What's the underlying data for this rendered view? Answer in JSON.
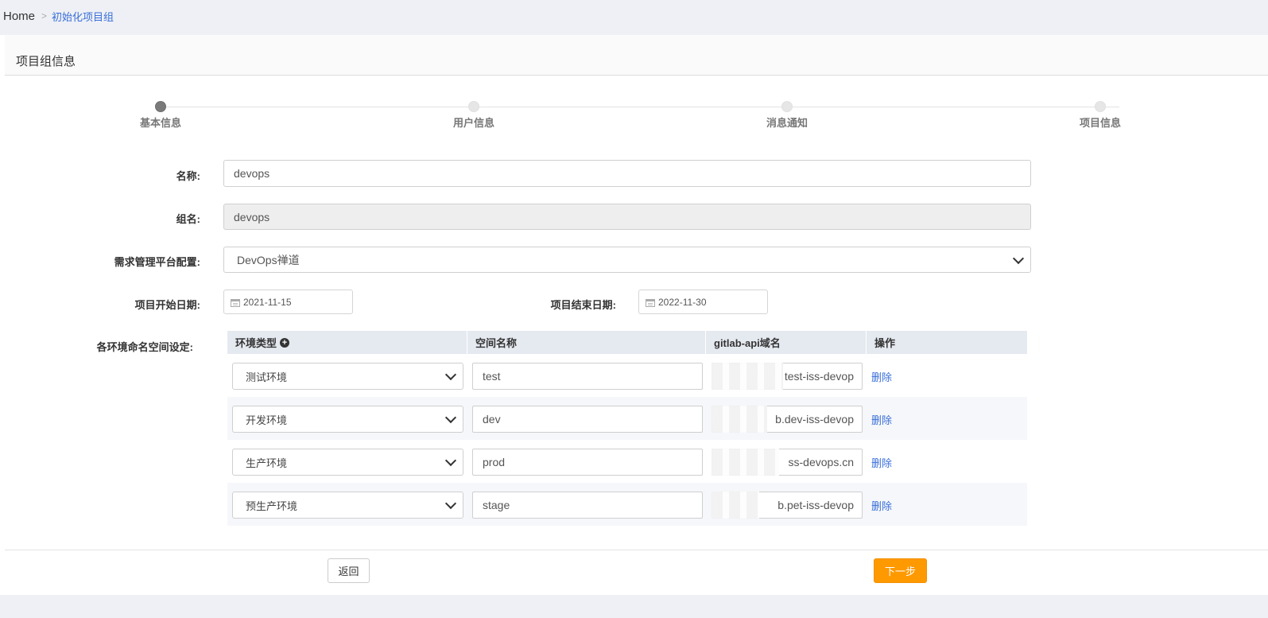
{
  "breadcrumb": {
    "home": "Home",
    "separator": ">",
    "current": "初始化项目组"
  },
  "card": {
    "title": "项目组信息"
  },
  "steps": [
    "基本信息",
    "用户信息",
    "消息通知",
    "项目信息"
  ],
  "form": {
    "name_label": "名称:",
    "name_value": "devops",
    "group_label": "组名:",
    "group_value": "devops",
    "platform_label": "需求管理平台配置:",
    "platform_value": "DevOps禅道",
    "start_label": "项目开始日期:",
    "start_value": "2021-11-15",
    "end_label": "项目结束日期:",
    "end_value": "2022-11-30",
    "env_label": "各环境命名空间设定:"
  },
  "env_table": {
    "headers": [
      "环境类型",
      "空间名称",
      "gitlab-api域名",
      "操作"
    ],
    "rows": [
      {
        "type": "测试环境",
        "space": "test",
        "api": "test-iss-devop",
        "action": "删除"
      },
      {
        "type": "开发环境",
        "space": "dev",
        "api": "b.dev-iss-devop",
        "action": "删除"
      },
      {
        "type": "生产环境",
        "space": "prod",
        "api": "ss-devops.cn",
        "action": "删除"
      },
      {
        "type": "预生产环境",
        "space": "stage",
        "api": "b.pet-iss-devop",
        "action": "删除"
      }
    ]
  },
  "buttons": {
    "back": "返回",
    "next": "下一步"
  },
  "colors": {
    "accent": "#3a6fd8",
    "primary_button": "#ff9900",
    "step_active": "#7a7a7a"
  }
}
